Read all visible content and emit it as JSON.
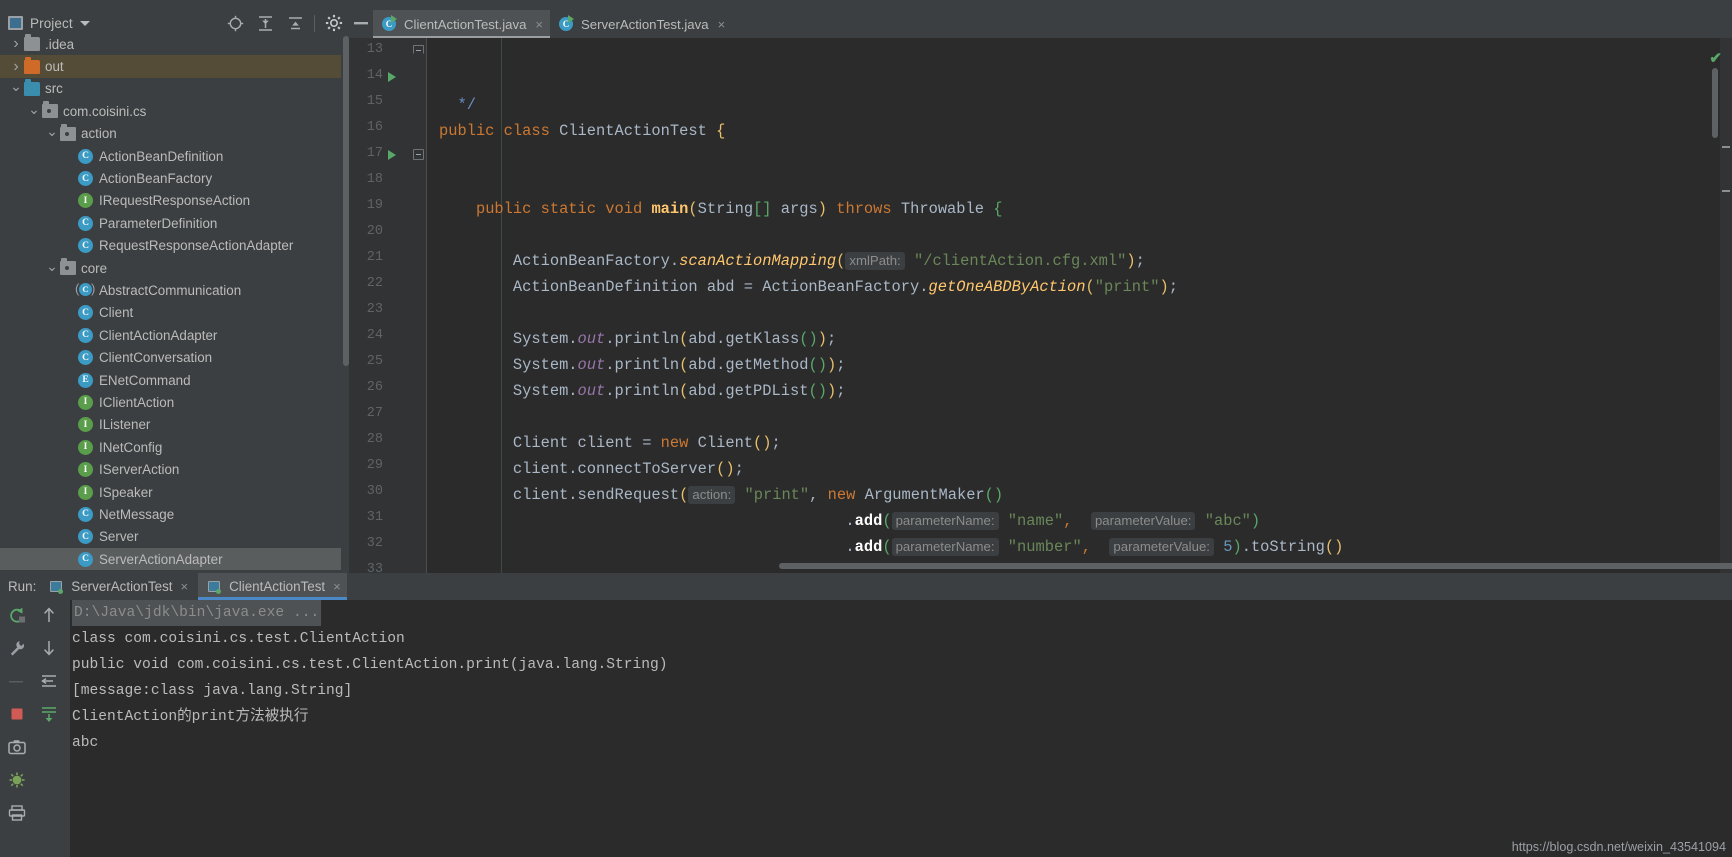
{
  "window": {
    "bg": "#3c3f41",
    "editor_bg": "#2b2b2b"
  },
  "project_panel": {
    "title": "Project",
    "icon": "project-window-icon",
    "caret": "chevron-down-icon",
    "toolbar": [
      {
        "name": "locate-icon",
        "tooltip": "Select Opened File"
      },
      {
        "name": "expand-all-icon",
        "tooltip": "Expand All"
      },
      {
        "name": "collapse-all-icon",
        "tooltip": "Collapse All"
      },
      {
        "name": "gear-icon",
        "tooltip": "Settings"
      }
    ],
    "tree": [
      {
        "label": ".idea",
        "icon": "folder-grey-icon",
        "twisty": "right",
        "indent": 1,
        "selected": "none"
      },
      {
        "label": "out",
        "icon": "folder-orange-icon",
        "twisty": "right",
        "indent": 1,
        "selected": "warm"
      },
      {
        "label": "src",
        "icon": "folder-blue-icon",
        "twisty": "down",
        "indent": 1,
        "selected": "none"
      },
      {
        "label": "com.coisini.cs",
        "icon": "package-icon",
        "twisty": "down",
        "indent": 2,
        "selected": "none"
      },
      {
        "label": "action",
        "icon": "package-icon",
        "twisty": "down",
        "indent": 3,
        "selected": "none"
      },
      {
        "label": "ActionBeanDefinition",
        "icon": "class-icon",
        "twisty": "none",
        "indent": 4,
        "selected": "none"
      },
      {
        "label": "ActionBeanFactory",
        "icon": "class-icon",
        "twisty": "none",
        "indent": 4,
        "selected": "none"
      },
      {
        "label": "IRequestResponseAction",
        "icon": "interface-icon",
        "twisty": "none",
        "indent": 4,
        "selected": "none"
      },
      {
        "label": "ParameterDefinition",
        "icon": "class-icon",
        "twisty": "none",
        "indent": 4,
        "selected": "none"
      },
      {
        "label": "RequestResponseActionAdapter",
        "icon": "class-icon",
        "twisty": "none",
        "indent": 4,
        "selected": "none"
      },
      {
        "label": "core",
        "icon": "package-icon",
        "twisty": "down",
        "indent": 3,
        "selected": "none"
      },
      {
        "label": "AbstractCommunication",
        "icon": "abstract-class-icon",
        "twisty": "none",
        "indent": 4,
        "selected": "none"
      },
      {
        "label": "Client",
        "icon": "class-icon",
        "twisty": "none",
        "indent": 4,
        "selected": "none"
      },
      {
        "label": "ClientActionAdapter",
        "icon": "class-icon",
        "twisty": "none",
        "indent": 4,
        "selected": "none"
      },
      {
        "label": "ClientConversation",
        "icon": "class-icon",
        "twisty": "none",
        "indent": 4,
        "selected": "none"
      },
      {
        "label": "ENetCommand",
        "icon": "enum-icon",
        "twisty": "none",
        "indent": 4,
        "selected": "none"
      },
      {
        "label": "IClientAction",
        "icon": "interface-icon",
        "twisty": "none",
        "indent": 4,
        "selected": "none"
      },
      {
        "label": "IListener",
        "icon": "interface-icon",
        "twisty": "none",
        "indent": 4,
        "selected": "none"
      },
      {
        "label": "INetConfig",
        "icon": "interface-icon",
        "twisty": "none",
        "indent": 4,
        "selected": "none"
      },
      {
        "label": "IServerAction",
        "icon": "interface-icon",
        "twisty": "none",
        "indent": 4,
        "selected": "none"
      },
      {
        "label": "ISpeaker",
        "icon": "interface-icon",
        "twisty": "none",
        "indent": 4,
        "selected": "none"
      },
      {
        "label": "NetMessage",
        "icon": "class-icon",
        "twisty": "none",
        "indent": 4,
        "selected": "none"
      },
      {
        "label": "Server",
        "icon": "class-icon",
        "twisty": "none",
        "indent": 4,
        "selected": "none"
      },
      {
        "label": "ServerActionAdapter",
        "icon": "class-icon",
        "twisty": "none",
        "indent": 4,
        "selected": "gray"
      }
    ]
  },
  "editor_tabs": {
    "minimize_icon": "minimize-icon",
    "tabs": [
      {
        "label": "ClientActionTest.java",
        "icon": "runnable-class-icon",
        "active": true,
        "close": "×"
      },
      {
        "label": "ServerActionTest.java",
        "icon": "runnable-class-icon",
        "active": false,
        "close": "×"
      }
    ]
  },
  "editor": {
    "inspection_status": "✔",
    "first_line": 13,
    "lines": [
      {
        "no": 13,
        "run": false,
        "fold": "end",
        "segs": [
          {
            "t": "  ",
            "c": "cls"
          },
          {
            "t": "*/",
            "c": "doc"
          }
        ]
      },
      {
        "no": 14,
        "run": true,
        "fold": "none",
        "segs": [
          {
            "t": "public ",
            "c": "k"
          },
          {
            "t": "class ",
            "c": "k"
          },
          {
            "t": "ClientActionTest ",
            "c": "cls"
          },
          {
            "t": "{",
            "c": "p1"
          }
        ]
      },
      {
        "no": 15,
        "run": false,
        "fold": "none",
        "segs": []
      },
      {
        "no": 16,
        "run": false,
        "fold": "none",
        "segs": []
      },
      {
        "no": 17,
        "run": true,
        "fold": "start",
        "segs": [
          {
            "t": "    ",
            "c": "cls"
          },
          {
            "t": "public static void ",
            "c": "k"
          },
          {
            "t": "main",
            "c": "mtdb"
          },
          {
            "t": "(",
            "c": "p1"
          },
          {
            "t": "String",
            "c": "cls"
          },
          {
            "t": "[]",
            "c": "p2"
          },
          {
            "t": " args",
            "c": "cls"
          },
          {
            "t": ")",
            "c": "p1"
          },
          {
            "t": " throws ",
            "c": "k"
          },
          {
            "t": "Throwable ",
            "c": "cls"
          },
          {
            "t": "{",
            "c": "p2"
          }
        ]
      },
      {
        "no": 18,
        "run": false,
        "fold": "none",
        "segs": []
      },
      {
        "no": 19,
        "run": false,
        "fold": "none",
        "segs": [
          {
            "t": "        ActionBeanFactory.",
            "c": "cls"
          },
          {
            "t": "scanActionMapping",
            "c": "mtd"
          },
          {
            "t": "(",
            "c": "p1"
          },
          {
            "t": "xmlPath:",
            "c": "hint"
          },
          {
            "t": " ",
            "c": "cls"
          },
          {
            "t": "\"/clientAction.cfg.xml\"",
            "c": "str"
          },
          {
            "t": ")",
            "c": "p1"
          },
          {
            "t": ";",
            "c": "cls"
          }
        ]
      },
      {
        "no": 20,
        "run": false,
        "fold": "none",
        "segs": [
          {
            "t": "        ActionBeanDefinition abd = ActionBeanFactory.",
            "c": "cls"
          },
          {
            "t": "getOneABDByAction",
            "c": "mtd"
          },
          {
            "t": "(",
            "c": "p1"
          },
          {
            "t": "\"print\"",
            "c": "str"
          },
          {
            "t": ")",
            "c": "p1"
          },
          {
            "t": ";",
            "c": "cls"
          }
        ]
      },
      {
        "no": 21,
        "run": false,
        "fold": "none",
        "segs": []
      },
      {
        "no": 22,
        "run": false,
        "fold": "none",
        "segs": [
          {
            "t": "        System.",
            "c": "cls"
          },
          {
            "t": "out",
            "c": "sfld"
          },
          {
            "t": ".println",
            "c": "cls"
          },
          {
            "t": "(",
            "c": "p1"
          },
          {
            "t": "abd.getKlass",
            "c": "cls"
          },
          {
            "t": "()",
            "c": "p2"
          },
          {
            "t": ")",
            "c": "p1"
          },
          {
            "t": ";",
            "c": "cls"
          }
        ]
      },
      {
        "no": 23,
        "run": false,
        "fold": "none",
        "segs": [
          {
            "t": "        System.",
            "c": "cls"
          },
          {
            "t": "out",
            "c": "sfld"
          },
          {
            "t": ".println",
            "c": "cls"
          },
          {
            "t": "(",
            "c": "p1"
          },
          {
            "t": "abd.getMethod",
            "c": "cls"
          },
          {
            "t": "()",
            "c": "p2"
          },
          {
            "t": ")",
            "c": "p1"
          },
          {
            "t": ";",
            "c": "cls"
          }
        ]
      },
      {
        "no": 24,
        "run": false,
        "fold": "none",
        "segs": [
          {
            "t": "        System.",
            "c": "cls"
          },
          {
            "t": "out",
            "c": "sfld"
          },
          {
            "t": ".println",
            "c": "cls"
          },
          {
            "t": "(",
            "c": "p1"
          },
          {
            "t": "abd.getPDList",
            "c": "cls"
          },
          {
            "t": "()",
            "c": "p2"
          },
          {
            "t": ")",
            "c": "p1"
          },
          {
            "t": ";",
            "c": "cls"
          }
        ]
      },
      {
        "no": 25,
        "run": false,
        "fold": "none",
        "segs": []
      },
      {
        "no": 26,
        "run": false,
        "fold": "none",
        "segs": [
          {
            "t": "        Client client = ",
            "c": "cls"
          },
          {
            "t": "new ",
            "c": "k"
          },
          {
            "t": "Client",
            "c": "cls"
          },
          {
            "t": "()",
            "c": "p1"
          },
          {
            "t": ";",
            "c": "cls"
          }
        ]
      },
      {
        "no": 27,
        "run": false,
        "fold": "none",
        "segs": [
          {
            "t": "        client.connectToServer",
            "c": "cls"
          },
          {
            "t": "()",
            "c": "p1"
          },
          {
            "t": ";",
            "c": "cls"
          }
        ]
      },
      {
        "no": 28,
        "run": false,
        "fold": "none",
        "segs": [
          {
            "t": "        client.sendRequest",
            "c": "cls"
          },
          {
            "t": "(",
            "c": "p1"
          },
          {
            "t": "action:",
            "c": "hint"
          },
          {
            "t": " ",
            "c": "cls"
          },
          {
            "t": "\"print\"",
            "c": "str"
          },
          {
            "t": ", ",
            "c": "cls"
          },
          {
            "t": "new ",
            "c": "k"
          },
          {
            "t": "ArgumentMaker",
            "c": "cls"
          },
          {
            "t": "()",
            "c": "p2"
          }
        ]
      },
      {
        "no": 29,
        "run": false,
        "fold": "none",
        "segs": [
          {
            "t": "                                            .",
            "c": "cls"
          },
          {
            "t": "add",
            "c": "white-b"
          },
          {
            "t": "(",
            "c": "p2"
          },
          {
            "t": "parameterName:",
            "c": "hint"
          },
          {
            "t": " ",
            "c": "cls"
          },
          {
            "t": "\"name\"",
            "c": "str"
          },
          {
            "t": ",",
            "c": "k"
          },
          {
            "t": "  ",
            "c": "cls"
          },
          {
            "t": "parameterValue:",
            "c": "hint"
          },
          {
            "t": " ",
            "c": "cls"
          },
          {
            "t": "\"abc\"",
            "c": "str"
          },
          {
            "t": ")",
            "c": "p2"
          }
        ]
      },
      {
        "no": 30,
        "run": false,
        "fold": "none",
        "segs": [
          {
            "t": "                                            .",
            "c": "cls"
          },
          {
            "t": "add",
            "c": "white-b"
          },
          {
            "t": "(",
            "c": "p2"
          },
          {
            "t": "parameterName:",
            "c": "hint"
          },
          {
            "t": " ",
            "c": "cls"
          },
          {
            "t": "\"number\"",
            "c": "str"
          },
          {
            "t": ",",
            "c": "k"
          },
          {
            "t": "  ",
            "c": "cls"
          },
          {
            "t": "parameterValue:",
            "c": "hint"
          },
          {
            "t": " ",
            "c": "cls"
          },
          {
            "t": "5",
            "c": "num"
          },
          {
            "t": ")",
            "c": "p2"
          },
          {
            "t": ".toString",
            "c": "cls"
          },
          {
            "t": "()",
            "c": "p1"
          }
        ]
      },
      {
        "no": 31,
        "run": false,
        "fold": "none",
        "segs": []
      },
      {
        "no": 32,
        "run": false,
        "fold": "none",
        "segs": []
      },
      {
        "no": 33,
        "run": false,
        "fold": "none",
        "segs": []
      }
    ]
  },
  "run_panel": {
    "label": "Run:",
    "tabs": [
      {
        "label": "ServerActionTest",
        "icon": "run-config-icon",
        "active": false,
        "close": "×"
      },
      {
        "label": "ClientActionTest",
        "icon": "run-config-icon",
        "active": true,
        "close": "×"
      }
    ],
    "active_underline_color": "#4a88c7",
    "gutter_buttons": [
      {
        "name": "rerun-icon"
      },
      {
        "name": "up-arrow-icon"
      },
      {
        "name": "wrench-icon"
      },
      {
        "name": "down-arrow-icon"
      },
      {
        "name": "soft-wrap-icon"
      },
      {
        "name": "stop-icon"
      },
      {
        "name": "scroll-to-end-icon"
      },
      {
        "name": "camera-icon"
      },
      {
        "name": "print-icon"
      },
      {
        "name": "kill-process-icon"
      }
    ],
    "console": [
      {
        "text": "D:\\Java\\jdk\\bin\\java.exe ...",
        "style": "command"
      },
      {
        "text": "class com.coisini.cs.test.ClientAction",
        "style": "stdout"
      },
      {
        "text": "public void com.coisini.cs.test.ClientAction.print(java.lang.String)",
        "style": "stdout"
      },
      {
        "text": "[message:class java.lang.String]",
        "style": "stdout"
      },
      {
        "text": "ClientAction的print方法被执行",
        "style": "stdout"
      },
      {
        "text": "abc",
        "style": "stdout"
      }
    ]
  },
  "watermark": "https://blog.csdn.net/weixin_43541094"
}
